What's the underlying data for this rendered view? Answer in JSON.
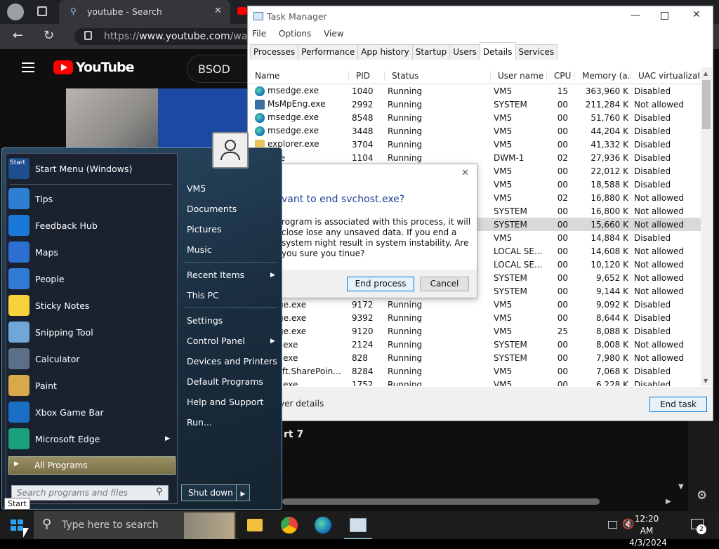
{
  "browser": {
    "tab_title": "youtube - Search",
    "url_prefix": "https://",
    "url_domain": "www.youtube.com",
    "url_rest": "/watch",
    "yt_brand": "YouTube",
    "search_text": "BSOD",
    "lower_text": "rt 7"
  },
  "taskmgr": {
    "title": "Task Manager",
    "menu": [
      "File",
      "Options",
      "View"
    ],
    "tabs": [
      "Processes",
      "Performance",
      "App history",
      "Startup",
      "Users",
      "Details",
      "Services"
    ],
    "active_tab": "Details",
    "columns": [
      "Name",
      "PID",
      "Status",
      "User name",
      "CPU",
      "Memory (a...",
      "UAC virtualizat..."
    ],
    "rows": [
      {
        "name": "msedge.exe",
        "icon": "edge-icon",
        "pid": "1040",
        "status": "Running",
        "user": "VM5",
        "cpu": "15",
        "mem": "363,960 K",
        "uac": "Disabled"
      },
      {
        "name": "MsMpEng.exe",
        "icon": "shield-icon",
        "pid": "2992",
        "status": "Running",
        "user": "SYSTEM",
        "cpu": "00",
        "mem": "211,284 K",
        "uac": "Not allowed"
      },
      {
        "name": "msedge.exe",
        "icon": "edge-icon",
        "pid": "8548",
        "status": "Running",
        "user": "VM5",
        "cpu": "00",
        "mem": "51,760 K",
        "uac": "Disabled"
      },
      {
        "name": "msedge.exe",
        "icon": "edge-icon",
        "pid": "3448",
        "status": "Running",
        "user": "VM5",
        "cpu": "00",
        "mem": "44,204 K",
        "uac": "Disabled"
      },
      {
        "name": "explorer.exe",
        "icon": "folder-icon",
        "pid": "3704",
        "status": "Running",
        "user": "VM5",
        "cpu": "00",
        "mem": "41,332 K",
        "uac": "Disabled"
      },
      {
        "name": ".exe",
        "icon": "",
        "pid": "1104",
        "status": "Running",
        "user": "DWM-1",
        "cpu": "02",
        "mem": "27,936 K",
        "uac": "Disabled"
      },
      {
        "name": "",
        "icon": "",
        "pid": "",
        "status": "",
        "user": "VM5",
        "cpu": "00",
        "mem": "22,012 K",
        "uac": "Disabled"
      },
      {
        "name": "",
        "icon": "",
        "pid": "",
        "status": "",
        "user": "VM5",
        "cpu": "00",
        "mem": "18,588 K",
        "uac": "Disabled"
      },
      {
        "name": "",
        "icon": "",
        "pid": "",
        "status": "",
        "user": "VM5",
        "cpu": "02",
        "mem": "16,880 K",
        "uac": "Not allowed"
      },
      {
        "name": "",
        "icon": "",
        "pid": "",
        "status": "",
        "user": "SYSTEM",
        "cpu": "00",
        "mem": "16,800 K",
        "uac": "Not allowed"
      },
      {
        "name": "",
        "icon": "",
        "pid": "",
        "status": "",
        "user": "SYSTEM",
        "cpu": "00",
        "mem": "15,660 K",
        "uac": "Not allowed",
        "selected": true
      },
      {
        "name": "",
        "icon": "",
        "pid": "",
        "status": "",
        "user": "VM5",
        "cpu": "00",
        "mem": "14,884 K",
        "uac": "Disabled"
      },
      {
        "name": "",
        "icon": "",
        "pid": "",
        "status": "",
        "user": "LOCAL SE...",
        "cpu": "00",
        "mem": "14,608 K",
        "uac": "Not allowed"
      },
      {
        "name": "",
        "icon": "",
        "pid": "",
        "status": "",
        "user": "LOCAL SE...",
        "cpu": "00",
        "mem": "10,120 K",
        "uac": "Not allowed"
      },
      {
        "name": "",
        "icon": "",
        "pid": "",
        "status": "",
        "user": "SYSTEM",
        "cpu": "00",
        "mem": "9,652 K",
        "uac": "Not allowed"
      },
      {
        "name": "",
        "icon": "",
        "pid": "",
        "status": "",
        "user": "SYSTEM",
        "cpu": "00",
        "mem": "9,144 K",
        "uac": "Not allowed"
      },
      {
        "name": "edge.exe",
        "icon": "",
        "pid": "9172",
        "status": "Running",
        "user": "VM5",
        "cpu": "00",
        "mem": "9,092 K",
        "uac": "Disabled"
      },
      {
        "name": "edge.exe",
        "icon": "",
        "pid": "9392",
        "status": "Running",
        "user": "VM5",
        "cpu": "00",
        "mem": "8,644 K",
        "uac": "Disabled"
      },
      {
        "name": "edge.exe",
        "icon": "",
        "pid": "9120",
        "status": "Running",
        "user": "VM5",
        "cpu": "25",
        "mem": "8,088 K",
        "uac": "Disabled"
      },
      {
        "name": "ost.exe",
        "icon": "",
        "pid": "2124",
        "status": "Running",
        "user": "SYSTEM",
        "cpu": "00",
        "mem": "8,008 K",
        "uac": "Not allowed"
      },
      {
        "name": "ost.exe",
        "icon": "",
        "pid": "828",
        "status": "Running",
        "user": "SYSTEM",
        "cpu": "00",
        "mem": "7,980 K",
        "uac": "Not allowed"
      },
      {
        "name": "osoft.SharePoin...",
        "icon": "",
        "pid": "8284",
        "status": "Running",
        "user": "VM5",
        "cpu": "00",
        "mem": "7,068 K",
        "uac": "Disabled"
      },
      {
        "name": "ost.exe",
        "icon": "",
        "pid": "1752",
        "status": "Running",
        "user": "VM5",
        "cpu": "00",
        "mem": "6,228 K",
        "uac": "Disabled"
      }
    ],
    "fewer_details": "ver details",
    "end_task": "End task"
  },
  "dialog": {
    "question": "vant to end svchost.exe?",
    "message": "rogram is associated with this process, it will close lose any unsaved data. If you end a system night result in system instability. Are you sure you tinue?",
    "end_process": "End process",
    "cancel": "Cancel"
  },
  "start_menu": {
    "header": "Start Menu (Windows)",
    "header_badge": "Start",
    "programs": [
      {
        "label": "Tips",
        "icon": "tips-icon",
        "color": "#2d7fd3"
      },
      {
        "label": "Feedback Hub",
        "icon": "feedback-hub-icon",
        "color": "#1a78d8"
      },
      {
        "label": "Maps",
        "icon": "maps-icon",
        "color": "#2d6fd0"
      },
      {
        "label": "People",
        "icon": "people-icon",
        "color": "#2f7bd6"
      },
      {
        "label": "Sticky Notes",
        "icon": "sticky-notes-icon",
        "color": "#f5d23a"
      },
      {
        "label": "Snipping Tool",
        "icon": "snipping-tool-icon",
        "color": "#6fa8d8"
      },
      {
        "label": "Calculator",
        "icon": "calculator-icon",
        "color": "#5b6f86"
      },
      {
        "label": "Paint",
        "icon": "paint-icon",
        "color": "#d9a84a"
      },
      {
        "label": "Xbox Game Bar",
        "icon": "xbox-game-bar-icon",
        "color": "#1a6fc4"
      },
      {
        "label": "Microsoft Edge",
        "icon": "edge-icon",
        "color": "#1aa07a"
      }
    ],
    "all_programs": "All Programs",
    "search_placeholder": "Search programs and files",
    "right": {
      "user": "VM5",
      "documents": "Documents",
      "pictures": "Pictures",
      "music": "Music",
      "recent_items": "Recent Items",
      "this_pc": "This PC",
      "settings": "Settings",
      "control_panel": "Control Panel",
      "devices_printers": "Devices and Printers",
      "default_programs": "Default Programs",
      "help_support": "Help and Support",
      "run": "Run..."
    },
    "shut_down": "Shut down",
    "tooltip": "Start"
  },
  "taskbar": {
    "search_placeholder": "Type here to search",
    "time": "12:20 AM",
    "date": "4/3/2024",
    "notification_count": "2"
  }
}
